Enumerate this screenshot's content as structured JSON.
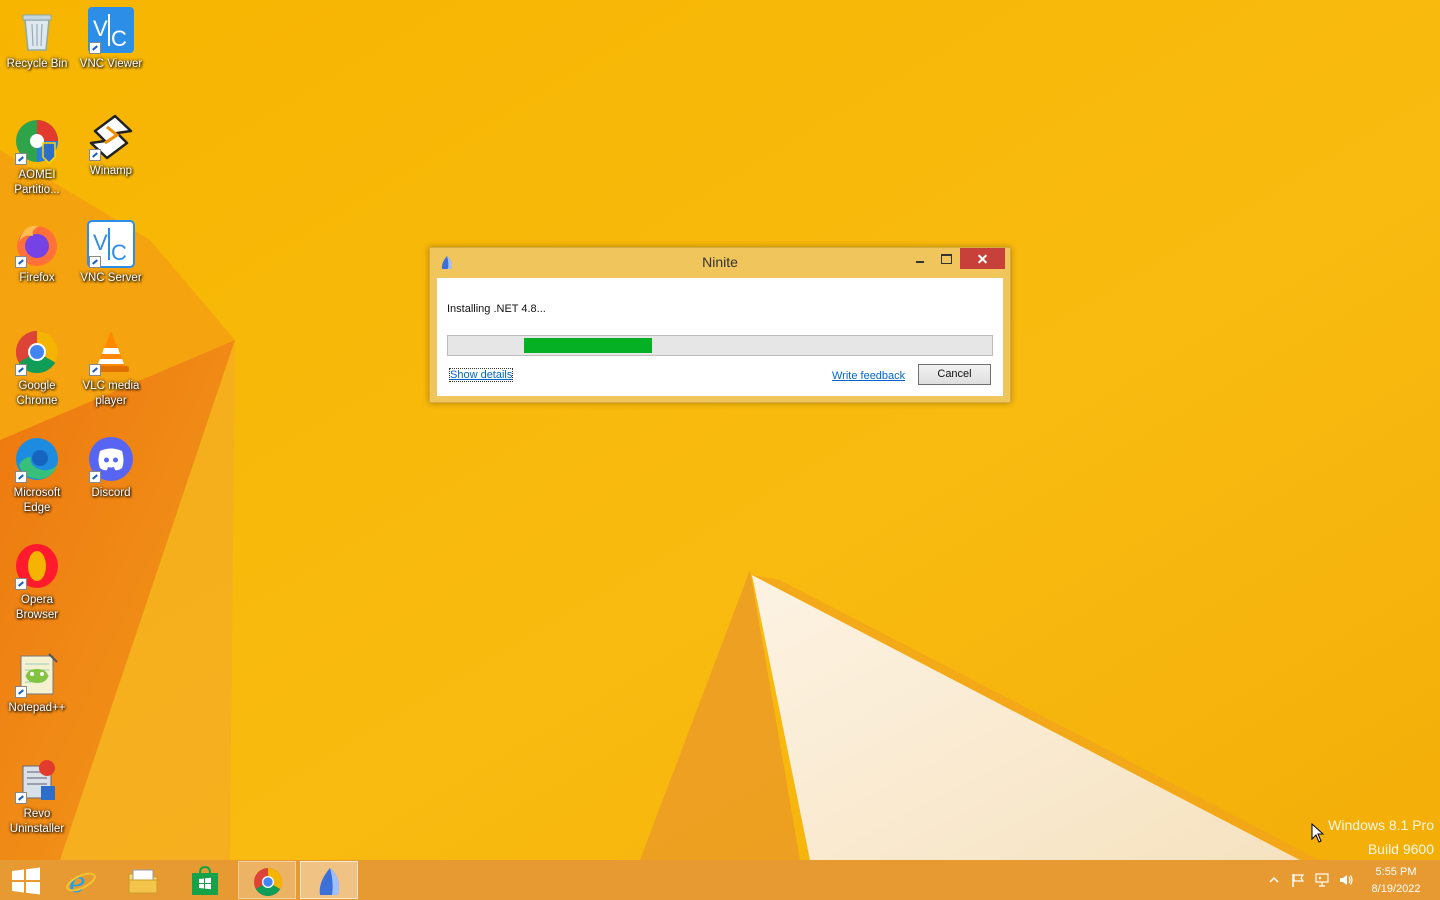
{
  "desktop": {
    "icons": [
      {
        "label": "Recycle Bin",
        "icon": "recycle-bin-icon"
      },
      {
        "label": "VNC Viewer",
        "icon": "vnc-viewer-icon"
      },
      {
        "label": "AOMEI Partitio...",
        "icon": "aomei-partition-icon"
      },
      {
        "label": "Winamp",
        "icon": "winamp-icon"
      },
      {
        "label": "Firefox",
        "icon": "firefox-icon"
      },
      {
        "label": "VNC Server",
        "icon": "vnc-server-icon"
      },
      {
        "label": "Google Chrome",
        "icon": "chrome-icon"
      },
      {
        "label": "VLC media player",
        "icon": "vlc-icon"
      },
      {
        "label": "Microsoft Edge",
        "icon": "edge-icon"
      },
      {
        "label": "Discord",
        "icon": "discord-icon"
      },
      {
        "label": "Opera Browser",
        "icon": "opera-icon"
      },
      {
        "label": "Notepad++",
        "icon": "notepad-plus-plus-icon"
      },
      {
        "label": "Revo Uninstaller",
        "icon": "revo-uninstaller-icon"
      }
    ]
  },
  "window": {
    "title": "Ninite",
    "status": "Installing .NET 4.8...",
    "progress_start": 0.14,
    "progress_end": 0.376,
    "show_details": "Show details",
    "write_feedback": "Write feedback",
    "cancel": "Cancel"
  },
  "watermark": {
    "line1": "Windows 8.1 Pro",
    "line2": "Build 9600"
  },
  "taskbar": {
    "items": [
      "start-icon",
      "internet-explorer-icon",
      "file-explorer-icon",
      "windows-store-icon",
      "chrome-icon",
      "ninite-icon"
    ],
    "time": "5:55 PM",
    "date": "8/19/2022"
  },
  "colors": {
    "wallpaper": "#f5b400",
    "progress": "#06b025",
    "close": "#c7403a"
  }
}
